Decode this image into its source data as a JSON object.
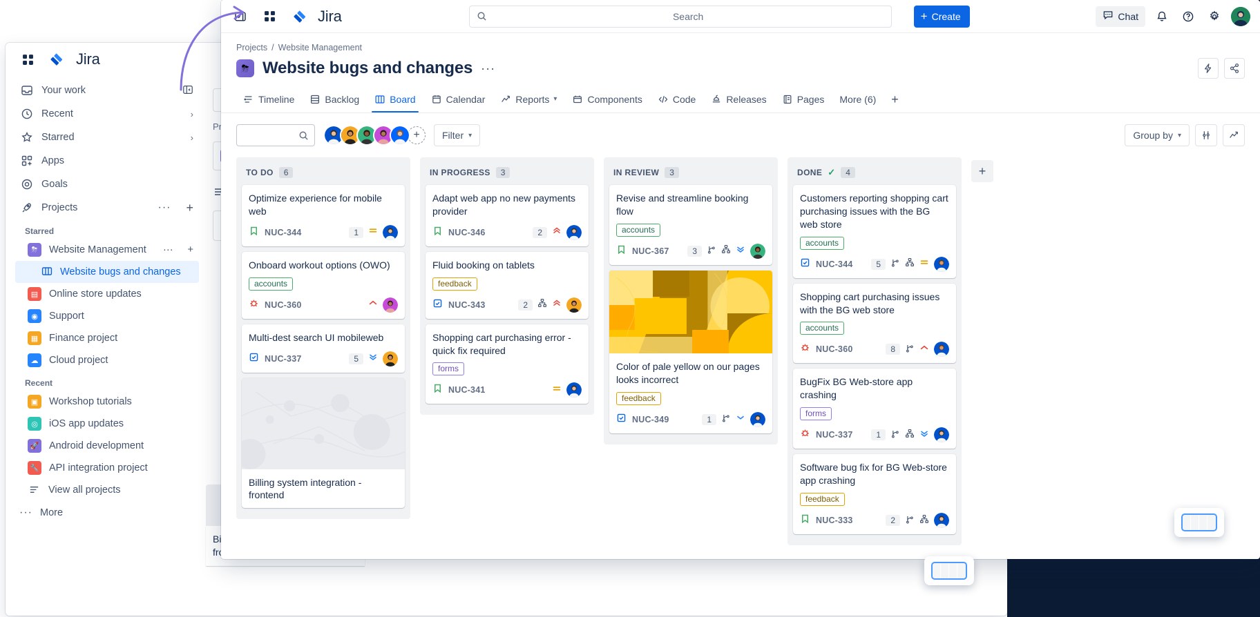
{
  "brand": {
    "name": "Jira",
    "accent": "#0C66E4",
    "done_green": "#22A06B"
  },
  "background_window": {
    "logo_text": "Jira",
    "nav": [
      {
        "label": "Your work",
        "icon": "tray-icon",
        "trailing": "collapse-icon"
      },
      {
        "label": "Recent",
        "icon": "clock-icon",
        "trailing": "chevron-right"
      },
      {
        "label": "Starred",
        "icon": "star-icon",
        "trailing": "chevron-right"
      },
      {
        "label": "Apps",
        "icon": "apps-icon",
        "trailing": ""
      },
      {
        "label": "Goals",
        "icon": "goal-icon",
        "trailing": ""
      },
      {
        "label": "Projects",
        "icon": "rocket-icon",
        "trailing": "more-plus"
      }
    ],
    "starred_label": "Starred",
    "starred_projects": [
      {
        "label": "Website Management",
        "color": "#8270DB",
        "glyph": "⛈",
        "trailing": "more-plus"
      },
      {
        "label": "Website bugs and changes",
        "color": "#0C66E4",
        "glyph": "▥",
        "active": true,
        "sub": true
      }
    ],
    "other_projects": [
      {
        "label": "Online store updates",
        "color": "#F15B50",
        "glyph": "▤"
      },
      {
        "label": "Support",
        "color": "#2684FF",
        "glyph": "◉"
      },
      {
        "label": "Finance project",
        "color": "#F5A623",
        "glyph": "▦"
      },
      {
        "label": "Cloud project",
        "color": "#2684FF",
        "glyph": "☁"
      }
    ],
    "recent_label": "Recent",
    "recent_projects": [
      {
        "label": "Workshop tutorials",
        "color": "#F5A623",
        "glyph": "▣"
      },
      {
        "label": "iOS app updates",
        "color": "#2EC4B6",
        "glyph": "◎"
      },
      {
        "label": "Android development",
        "color": "#8270DB",
        "glyph": "🚀"
      },
      {
        "label": "API integration project",
        "color": "#F15B50",
        "glyph": "🔧"
      }
    ],
    "view_all_label": "View all projects",
    "more_label": "More",
    "main_ghost": {
      "breadcrumb": "Pro...",
      "search_placeholder": ""
    }
  },
  "topbar": {
    "sidebar_toggle_icon": "sidebar-expand-icon",
    "app_switcher_icon": "app-switcher-icon",
    "logo_text": "Jira",
    "search_placeholder": "Search",
    "search_icon": "search-icon",
    "create_label": "Create",
    "chat_label": "Chat",
    "chat_icon": "chat-icon",
    "notifications_icon": "bell-icon",
    "help_icon": "help-icon",
    "settings_icon": "gear-icon",
    "avatar_icon": "user-avatar"
  },
  "project_header": {
    "breadcrumb": [
      "Projects",
      "Website Management"
    ],
    "breadcrumb_separator": "/",
    "title": "Website bugs and changes",
    "more_actions": "···",
    "actions": [
      {
        "name": "automation-button",
        "icon": "lightning-icon"
      },
      {
        "name": "share-button",
        "icon": "share-icon"
      }
    ]
  },
  "tabs": [
    {
      "label": "Timeline",
      "icon": "timeline-icon",
      "active": false
    },
    {
      "label": "Backlog",
      "icon": "backlog-icon",
      "active": false
    },
    {
      "label": "Board",
      "icon": "board-icon",
      "active": true
    },
    {
      "label": "Calendar",
      "icon": "calendar-icon",
      "active": false
    },
    {
      "label": "Reports",
      "icon": "reports-icon",
      "active": false,
      "chevron": true
    },
    {
      "label": "Components",
      "icon": "components-icon",
      "active": false
    },
    {
      "label": "Code",
      "icon": "code-icon",
      "active": false
    },
    {
      "label": "Releases",
      "icon": "releases-icon",
      "active": false
    },
    {
      "label": "Pages",
      "icon": "pages-icon",
      "active": false
    },
    {
      "label": "More (6)",
      "icon": "",
      "active": false
    }
  ],
  "tab_add_label": "+",
  "board_controls": {
    "search_placeholder": "",
    "search_icon": "search-icon",
    "avatars": [
      "#0052CC",
      "#F5A623",
      "#36B37E",
      "#C74BD9",
      "#0065FF"
    ],
    "add_people_label": "+",
    "filter_label": "Filter",
    "group_by_label": "Group by",
    "settings_icon": "sliders-icon",
    "insights_icon": "insights-icon"
  },
  "columns": [
    {
      "name": "TO DO",
      "count": "6",
      "done_check": false,
      "cards": [
        {
          "title": "Optimize experience for mobile web",
          "labels": [],
          "type_icon": "story-icon",
          "key": "NUC-344",
          "badge": "1",
          "icons": [
            "priority-medium"
          ],
          "avatar": "#0052CC"
        },
        {
          "title": "Onboard workout options (OWO)",
          "labels": [
            {
              "text": "accounts",
              "style": "accounts"
            }
          ],
          "type_icon": "bug-icon",
          "key": "NUC-360",
          "badge": "",
          "icons": [
            "priority-high"
          ],
          "avatar": "#C74BD9"
        },
        {
          "title": "Multi-dest search UI mobileweb",
          "labels": [],
          "type_icon": "task-icon",
          "key": "NUC-337",
          "badge": "5",
          "icons": [
            "priority-lowest"
          ],
          "avatar": "#F5A623"
        },
        {
          "title": "Billing system integration - frontend",
          "labels": [],
          "cover": "placeholder",
          "type_icon": "",
          "key": "",
          "badge": "",
          "icons": [],
          "avatar": ""
        }
      ]
    },
    {
      "name": "IN PROGRESS",
      "count": "3",
      "done_check": false,
      "cards": [
        {
          "title": "Adapt web app no new payments provider",
          "labels": [],
          "type_icon": "story-icon",
          "key": "NUC-346",
          "badge": "2",
          "icons": [
            "priority-highest"
          ],
          "avatar": "#0052CC"
        },
        {
          "title": "Fluid booking on tablets",
          "labels": [
            {
              "text": "feedback",
              "style": "feedback"
            }
          ],
          "type_icon": "task-icon",
          "key": "NUC-343",
          "badge": "2",
          "icons": [
            "subtasks-icon",
            "priority-highest"
          ],
          "avatar": "#F5A623"
        },
        {
          "title": "Shopping cart purchasing error - quick fix required",
          "labels": [
            {
              "text": "forms",
              "style": "forms"
            }
          ],
          "type_icon": "story-icon",
          "key": "NUC-341",
          "badge": "",
          "icons": [
            "priority-medium"
          ],
          "avatar": "#0052CC"
        }
      ]
    },
    {
      "name": "IN REVIEW",
      "count": "3",
      "done_check": false,
      "cards": [
        {
          "title": "Revise and streamline booking flow",
          "labels": [
            {
              "text": "accounts",
              "style": "accounts"
            }
          ],
          "type_icon": "story-icon",
          "key": "NUC-367",
          "badge": "3",
          "icons": [
            "branch-icon",
            "subtasks-icon",
            "priority-lowest"
          ],
          "avatar": "#36B37E"
        },
        {
          "title": "Color of pale yellow on our pages looks incorrect",
          "labels": [
            {
              "text": "feedback",
              "style": "feedback"
            }
          ],
          "cover": "yellow-abstract",
          "type_icon": "task-icon",
          "key": "NUC-349",
          "badge": "1",
          "icons": [
            "branch-icon",
            "priority-low"
          ],
          "avatar": "#0052CC"
        }
      ]
    },
    {
      "name": "DONE",
      "count": "4",
      "done_check": true,
      "cards": [
        {
          "title": "Customers reporting shopping cart purchasing issues with the BG web store",
          "labels": [
            {
              "text": "accounts",
              "style": "accounts"
            }
          ],
          "type_icon": "task-icon",
          "key": "NUC-344",
          "badge": "5",
          "icons": [
            "branch-icon",
            "subtasks-icon",
            "priority-medium"
          ],
          "avatar": "#0052CC"
        },
        {
          "title": "Shopping cart purchasing issues with the BG web store",
          "labels": [
            {
              "text": "accounts",
              "style": "accounts"
            }
          ],
          "type_icon": "bug-icon",
          "key": "NUC-360",
          "badge": "8",
          "icons": [
            "branch-icon",
            "priority-high"
          ],
          "avatar": "#0052CC"
        },
        {
          "title": "BugFix BG Web-store app crashing",
          "labels": [
            {
              "text": "forms",
              "style": "forms"
            }
          ],
          "type_icon": "bug-icon",
          "key": "NUC-337",
          "badge": "1",
          "icons": [
            "branch-icon",
            "subtasks-icon",
            "priority-lowest"
          ],
          "avatar": "#0052CC"
        },
        {
          "title": "Software bug fix for BG Web-store app crashing",
          "labels": [
            {
              "text": "feedback",
              "style": "feedback"
            }
          ],
          "type_icon": "story-icon",
          "key": "NUC-333",
          "badge": "2",
          "icons": [
            "branch-icon",
            "subtasks-icon"
          ],
          "avatar": "#0052CC"
        }
      ]
    }
  ],
  "add_column_label": "+",
  "overlay_chips": [
    {
      "name": "board-view-chip-right"
    },
    {
      "name": "board-view-chip-center"
    }
  ],
  "bottom_fragments": {
    "todo_card_title": "Billing system integration - frontend",
    "done_card_title_fragment": "store app crashing",
    "done_card_label": "feedback"
  }
}
